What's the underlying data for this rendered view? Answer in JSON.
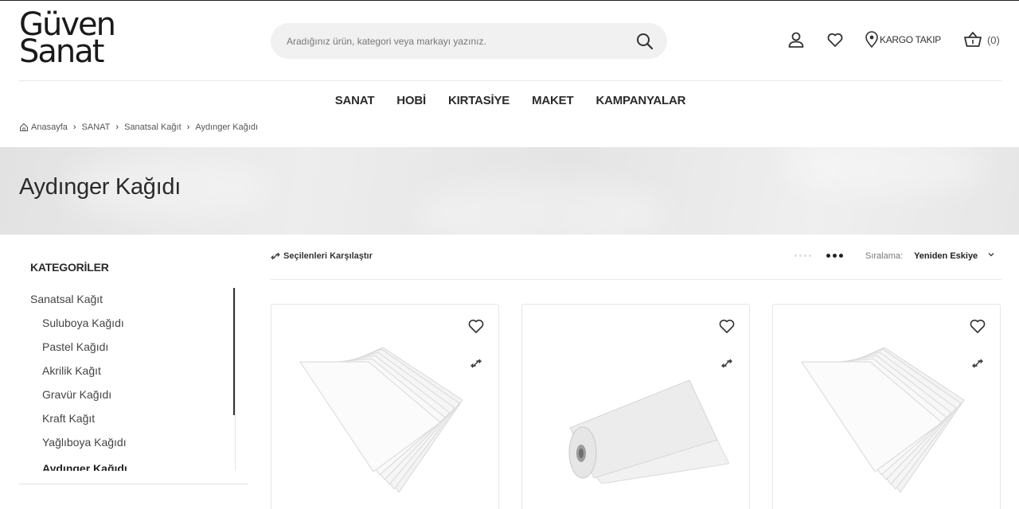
{
  "brand": {
    "line1": "Güven",
    "line2": "Sanat"
  },
  "search": {
    "placeholder": "Aradığınız ürün, kategori veya markayı yazınız."
  },
  "header": {
    "kargo_label": "KARGO TAKIP",
    "cart_count": "(0)"
  },
  "nav": [
    "SANAT",
    "HOBİ",
    "KIRTASİYE",
    "MAKET",
    "KAMPANYALAR"
  ],
  "breadcrumb": [
    "Anasayfa",
    "SANAT",
    "Sanatsal Kağıt",
    "Aydınger Kağıdı"
  ],
  "page": {
    "title": "Aydınger Kağıdı"
  },
  "sidebar": {
    "title": "KATEGORİLER",
    "parent": "Sanatsal Kağıt",
    "items": [
      "Suluboya Kağıdı",
      "Pastel Kağıdı",
      "Akrilik Kağıt",
      "Gravür Kağıdı",
      "Kraft Kağıt",
      "Yağlıboya Kağıdı",
      "Aydınger Kağıdı"
    ],
    "active": "Aydınger Kağıdı"
  },
  "toolbar": {
    "compare_label": "Seçilenleri Karşılaştır",
    "sort_label": "Sıralama:",
    "sort_value": "Yeniden Eskiye"
  },
  "products": [
    {
      "image": "tracing-paper-sheets"
    },
    {
      "image": "tracing-paper-roll"
    },
    {
      "image": "tracing-paper-sheets"
    }
  ],
  "colors": {
    "text": "#2b2b2b",
    "search_bg": "#f1f1f1",
    "hero_bg": "#e6e6e6",
    "border": "#e6e6e6"
  }
}
